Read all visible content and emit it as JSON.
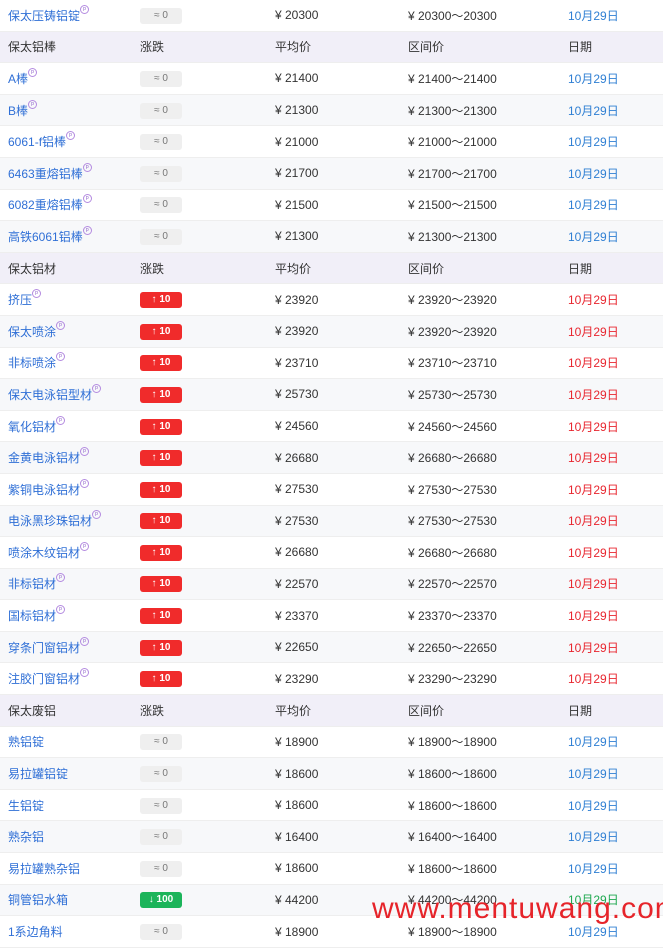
{
  "sections": [
    {
      "header": null,
      "rows": [
        {
          "name": "保太压铸铝锭",
          "mark": true,
          "change": "0",
          "trend": "flat",
          "avg": "¥ 20300",
          "range": "¥ 20300～20300",
          "date": "10月29日"
        }
      ]
    },
    {
      "header": {
        "name": "保太铝棒",
        "change": "涨跌",
        "avg": "平均价",
        "range": "区间价",
        "date": "日期"
      },
      "rows": [
        {
          "name": "A棒",
          "mark": true,
          "change": "0",
          "trend": "flat",
          "avg": "¥ 21400",
          "range": "¥ 21400～21400",
          "date": "10月29日"
        },
        {
          "name": "B棒",
          "mark": true,
          "change": "0",
          "trend": "flat",
          "avg": "¥ 21300",
          "range": "¥ 21300～21300",
          "date": "10月29日"
        },
        {
          "name": "6061-f铝棒",
          "mark": true,
          "change": "0",
          "trend": "flat",
          "avg": "¥ 21000",
          "range": "¥ 21000～21000",
          "date": "10月29日"
        },
        {
          "name": "6463重熔铝棒",
          "mark": true,
          "change": "0",
          "trend": "flat",
          "avg": "¥ 21700",
          "range": "¥ 21700～21700",
          "date": "10月29日"
        },
        {
          "name": "6082重熔铝棒",
          "mark": true,
          "change": "0",
          "trend": "flat",
          "avg": "¥ 21500",
          "range": "¥ 21500～21500",
          "date": "10月29日"
        },
        {
          "name": "高铁6061铝棒",
          "mark": true,
          "change": "0",
          "trend": "flat",
          "avg": "¥ 21300",
          "range": "¥ 21300～21300",
          "date": "10月29日"
        }
      ]
    },
    {
      "header": {
        "name": "保太铝材",
        "change": "涨跌",
        "avg": "平均价",
        "range": "区间价",
        "date": "日期"
      },
      "rows": [
        {
          "name": "挤压",
          "mark": true,
          "change": "10",
          "trend": "up",
          "avg": "¥ 23920",
          "range": "¥ 23920～23920",
          "date": "10月29日"
        },
        {
          "name": "保太喷涂",
          "mark": true,
          "change": "10",
          "trend": "up",
          "avg": "¥ 23920",
          "range": "¥ 23920～23920",
          "date": "10月29日"
        },
        {
          "name": "非标喷涂",
          "mark": true,
          "change": "10",
          "trend": "up",
          "avg": "¥ 23710",
          "range": "¥ 23710～23710",
          "date": "10月29日"
        },
        {
          "name": "保太电泳铝型材",
          "mark": true,
          "change": "10",
          "trend": "up",
          "avg": "¥ 25730",
          "range": "¥ 25730～25730",
          "date": "10月29日"
        },
        {
          "name": "氧化铝材",
          "mark": true,
          "change": "10",
          "trend": "up",
          "avg": "¥ 24560",
          "range": "¥ 24560～24560",
          "date": "10月29日"
        },
        {
          "name": "金黄电泳铝材",
          "mark": true,
          "change": "10",
          "trend": "up",
          "avg": "¥ 26680",
          "range": "¥ 26680～26680",
          "date": "10月29日"
        },
        {
          "name": "紫铜电泳铝材",
          "mark": true,
          "change": "10",
          "trend": "up",
          "avg": "¥ 27530",
          "range": "¥ 27530～27530",
          "date": "10月29日"
        },
        {
          "name": "电泳黑珍珠铝材",
          "mark": true,
          "change": "10",
          "trend": "up",
          "avg": "¥ 27530",
          "range": "¥ 27530～27530",
          "date": "10月29日"
        },
        {
          "name": "喷涂木纹铝材",
          "mark": true,
          "change": "10",
          "trend": "up",
          "avg": "¥ 26680",
          "range": "¥ 26680～26680",
          "date": "10月29日"
        },
        {
          "name": "非标铝材",
          "mark": true,
          "change": "10",
          "trend": "up",
          "avg": "¥ 22570",
          "range": "¥ 22570～22570",
          "date": "10月29日"
        },
        {
          "name": "国标铝材",
          "mark": true,
          "change": "10",
          "trend": "up",
          "avg": "¥ 23370",
          "range": "¥ 23370～23370",
          "date": "10月29日"
        },
        {
          "name": "穿条门窗铝材",
          "mark": true,
          "change": "10",
          "trend": "up",
          "avg": "¥ 22650",
          "range": "¥ 22650～22650",
          "date": "10月29日"
        },
        {
          "name": "注胶门窗铝材",
          "mark": true,
          "change": "10",
          "trend": "up",
          "avg": "¥ 23290",
          "range": "¥ 23290～23290",
          "date": "10月29日"
        }
      ]
    },
    {
      "header": {
        "name": "保太废铝",
        "change": "涨跌",
        "avg": "平均价",
        "range": "区间价",
        "date": "日期"
      },
      "rows": [
        {
          "name": "熟铝锭",
          "mark": false,
          "change": "0",
          "trend": "flat",
          "avg": "¥ 18900",
          "range": "¥ 18900～18900",
          "date": "10月29日"
        },
        {
          "name": "易拉罐铝锭",
          "mark": false,
          "change": "0",
          "trend": "flat",
          "avg": "¥ 18600",
          "range": "¥ 18600～18600",
          "date": "10月29日"
        },
        {
          "name": "生铝锭",
          "mark": false,
          "change": "0",
          "trend": "flat",
          "avg": "¥ 18600",
          "range": "¥ 18600～18600",
          "date": "10月29日"
        },
        {
          "name": "熟杂铝",
          "mark": false,
          "change": "0",
          "trend": "flat",
          "avg": "¥ 16400",
          "range": "¥ 16400～16400",
          "date": "10月29日"
        },
        {
          "name": "易拉罐熟杂铝",
          "mark": false,
          "change": "0",
          "trend": "flat",
          "avg": "¥ 18600",
          "range": "¥ 18600～18600",
          "date": "10月29日"
        },
        {
          "name": "铜管铝水箱",
          "mark": false,
          "change": "100",
          "trend": "down",
          "avg": "¥ 44200",
          "range": "¥ 44200～44200",
          "date": "10月29日"
        },
        {
          "name": "1系边角料",
          "mark": false,
          "change": "0",
          "trend": "flat",
          "avg": "¥ 18900",
          "range": "¥ 18900～18900",
          "date": "10月29日"
        }
      ]
    }
  ],
  "icons": {
    "flat": "≈",
    "up": "↑",
    "down": "↓",
    "mark": "p"
  },
  "colors": {
    "up": "#f02b2b",
    "down": "#1cb45a",
    "flat": "#efefef",
    "date_flat": "#2f7fd3",
    "date_up": "#e8262f",
    "date_down": "#1ea84f",
    "header_bg": "#f1eff8",
    "name_link": "#2f6fd6"
  },
  "watermark": "www.mentuwang.com"
}
